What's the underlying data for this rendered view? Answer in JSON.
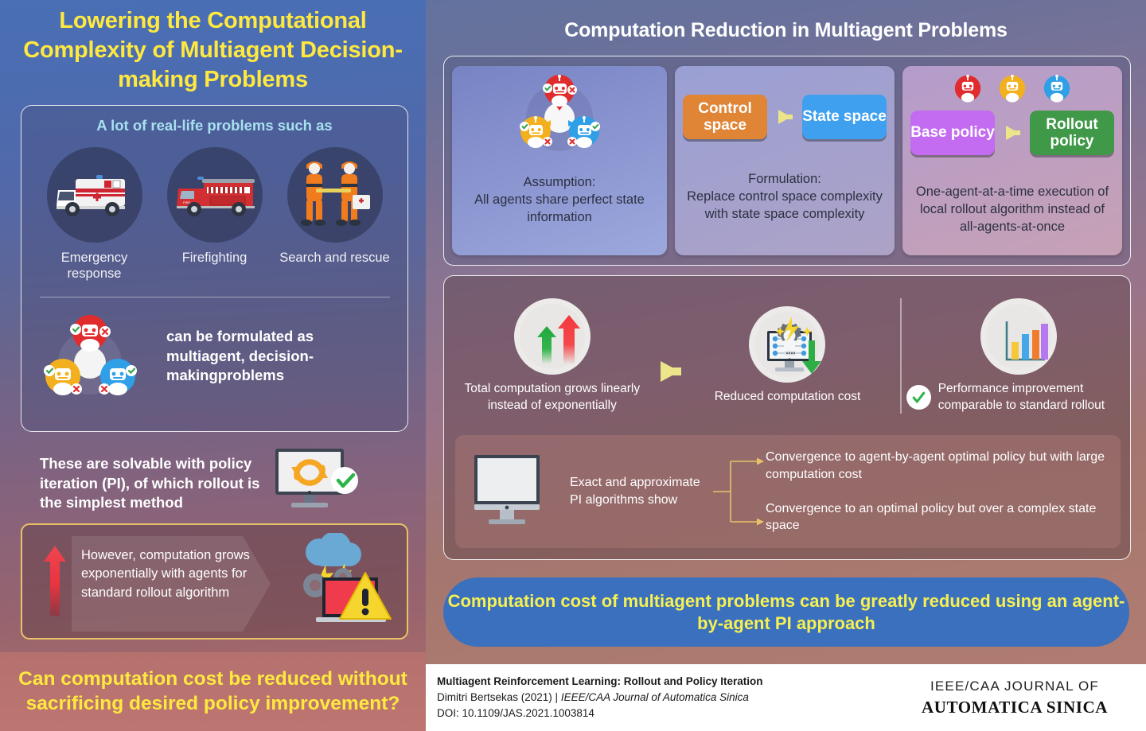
{
  "left": {
    "title": "Lowering the Computational Complexity of Multiagent Decision-making Problems",
    "problems_card": {
      "heading": "A lot of real-life problems such as",
      "items": [
        {
          "label": "Emergency response",
          "icon": "ambulance-icon"
        },
        {
          "label": "Firefighting",
          "icon": "firetruck-icon"
        },
        {
          "label": "Search and rescue",
          "icon": "rescue-workers-icon"
        }
      ],
      "formulation_text": "can be formulated as multiagent, decision-makingproblems"
    },
    "pi_text": "These are solvable with policy iteration (PI), of which rollout is the simplest method",
    "warning_text": "However, computation grows exponentially with agents for standard rollout algorithm",
    "bottom_question": "Can computation cost be reduced without sacrificing desired policy improvement?"
  },
  "right": {
    "title": "Computation Reduction in Multiagent Problems",
    "row1": [
      {
        "graphic": "three-agents-shared-state-icon",
        "caption": "Assumption:\nAll agents share perfect state information"
      },
      {
        "graphic": "control-to-state-arrow",
        "pill_from": "Control space",
        "pill_to": "State space",
        "caption": "Formulation:\nReplace control space complexity with state space complexity"
      },
      {
        "graphic": "base-to-rollout-arrow",
        "pill_from": "Base policy",
        "pill_to": "Rollout policy",
        "caption": "One-agent-at-a-time execution of local rollout algorithm instead of all-agents-at-once"
      }
    ],
    "stats": [
      {
        "icon": "two-up-arrows-icon",
        "text": "Total computation grows linearly instead of exponentially"
      },
      {
        "icon": "monitor-gear-down-arrow-icon",
        "text": "Reduced computation cost"
      },
      {
        "icon": "bar-chart-icon",
        "text": "Performance improvement comparable to standard rollout"
      }
    ],
    "pi_algorithms": {
      "icon": "desktop-monitor-icon",
      "label": "Exact and approximate PI algorithms show",
      "branches": [
        "Convergence to agent-by-agent optimal policy but with large computation cost",
        "Convergence to an optimal policy but over a complex state space"
      ]
    },
    "conclusion": "Computation cost of multiagent problems can be greatly reduced using an agent-by-agent PI approach"
  },
  "footer": {
    "paper_title": "Multiagent Reinforcement Learning: Rollout and Policy Iteration",
    "author_prefix": "Dimitri Bertsekas (2021) | ",
    "journal_italic": "IEEE/CAA Journal of Automatica Sinica",
    "doi": "DOI: 10.1109/JAS.2021.1003814",
    "journal_line1": "IEEE/CAA JOURNAL OF",
    "journal_line2": "AUTOMATICA SINICA"
  },
  "colors": {
    "title_yellow": "#ffe93f",
    "heading_cyan": "#a8e0ef",
    "control_orange": "#e08436",
    "state_blue": "#3fa0f0",
    "base_purple": "#c36cf2",
    "rollout_green": "#3f9949",
    "conclusion_blue": "#3a70bd",
    "conclusion_yellow": "#f7f052",
    "arrow_yellow": "#ece58a"
  }
}
